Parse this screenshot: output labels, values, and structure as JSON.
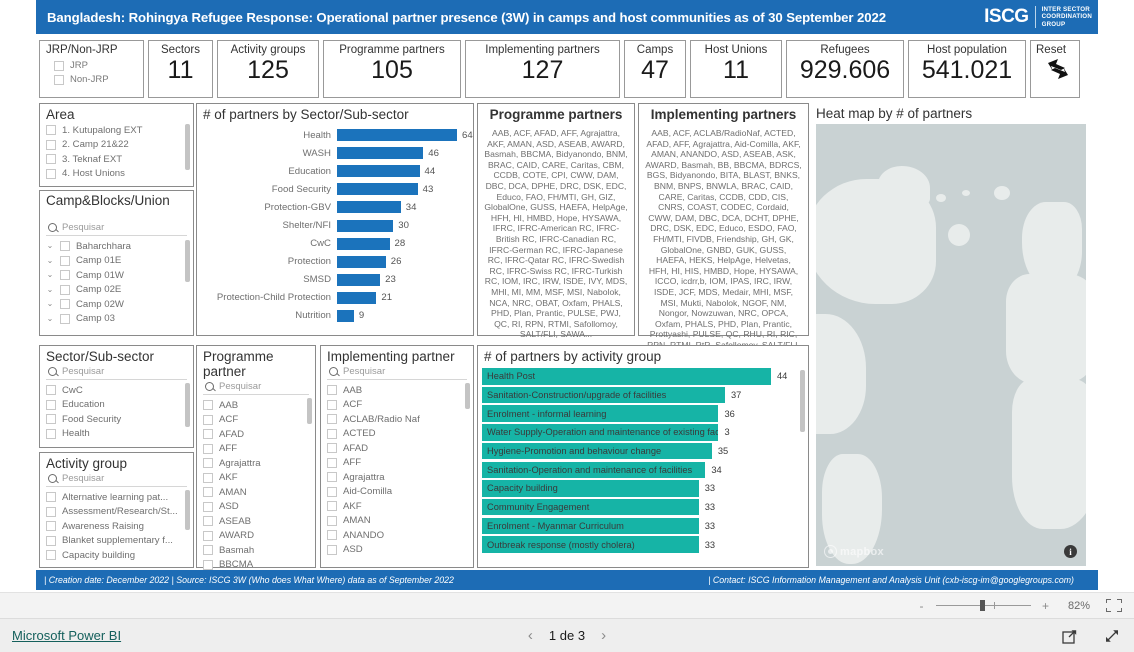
{
  "header": {
    "title": "Bangladesh: Rohingya Refugee Response: Operational partner presence (3W) in camps and host communities as of 30 September 2022",
    "logo_main": "ISCG",
    "logo_sub": "INTER SECTOR\nCOORDINATION\nGROUP",
    "bg_color": "#1d6cb5"
  },
  "kpis": {
    "jrp_slicer": {
      "label": "JRP/Non-JRP",
      "options": [
        "JRP",
        "Non-JRP"
      ]
    },
    "cards": [
      {
        "label": "Sectors",
        "value": "11"
      },
      {
        "label": "Activity groups",
        "value": "125"
      },
      {
        "label": "Programme partners",
        "value": "105"
      },
      {
        "label": "Implementing partners",
        "value": "127"
      },
      {
        "label": "Camps",
        "value": "47"
      },
      {
        "label": "Host Unions",
        "value": "11"
      },
      {
        "label": "Refugees",
        "value": "929.606"
      },
      {
        "label": "Host population",
        "value": "541.021"
      }
    ],
    "reset": {
      "label": "Reset",
      "icon": "reset-arrows-icon"
    }
  },
  "slicers": {
    "search_placeholder": "Pesquisar",
    "area": {
      "title": "Area",
      "items": [
        "1. Kutupalong EXT",
        "2. Camp 21&22",
        "3. Teknaf EXT",
        "4. Host Unions"
      ]
    },
    "camp_blocks": {
      "title": "Camp&Blocks/Union",
      "items": [
        "Baharchhara",
        "Camp 01E",
        "Camp 01W",
        "Camp 02E",
        "Camp 02W",
        "Camp 03"
      ]
    },
    "sector": {
      "title": "Sector/Sub-sector",
      "items": [
        "CwC",
        "Education",
        "Food Security",
        "Health"
      ]
    },
    "activity_group": {
      "title": "Activity group",
      "items": [
        "Alternative learning pat...",
        "Assessment/Research/St...",
        "Awareness Raising",
        "Blanket supplementary f...",
        "Capacity building"
      ]
    },
    "programme_partner": {
      "title": "Programme partner",
      "items": [
        "AAB",
        "ACF",
        "AFAD",
        "AFF",
        "Agrajattra",
        "AKF",
        "AMAN",
        "ASD",
        "ASEAB",
        "AWARD",
        "Basmah",
        "BBCMA"
      ]
    },
    "implementing_partner": {
      "title": "Implementing partner",
      "items": [
        "AAB",
        "ACF",
        "ACLAB/Radio Naf",
        "ACTED",
        "AFAD",
        "AFF",
        "Agrajattra",
        "Aid-Comilla",
        "AKF",
        "AMAN",
        "ANANDO",
        "ASD"
      ]
    }
  },
  "programme_partners_panel": {
    "title": "Programme partners",
    "text": "AAB, ACF, AFAD, AFF, Agrajattra, AKF, AMAN, ASD, ASEAB, AWARD, Basmah, BBCMA, Bidyanondo, BNM, BRAC, CAID, CARE, Caritas, CBM, CCDB, COTE, CPI, CWW, DAM, DBC, DCA, DPHE, DRC, DSK, EDC, Educo, FAO, FH/MTI, GH, GIZ, GlobalOne, GUSS, HAEFA, HelpAge, HFH, HI, HMBD, Hope, HYSAWA, IFRC, IFRC-American RC, IFRC-British RC, IFRC-Canadian RC, IFRC-German RC, IFRC-Japanese RC, IFRC-Qatar RC, IFRC-Swedish RC, IFRC-Swiss RC, IFRC-Turkish RC, IOM, IRC, IRW, ISDE, IVY, MDS, MHI, MI, MM, MSF, MSI, Nabolok, NCA, NRC, OBAT, Oxfam, PHALS, PHD, Plan, Prantic, PULSE, PWJ, QC, RI, RPN, RTMI, Safollomoy, SALT/FLI, SAWA..."
  },
  "implementing_partners_panel": {
    "title": "Implementing partners",
    "text": "AAB, ACF, ACLAB/RadioNaf, ACTED, AFAD, AFF, Agrajattra, Aid-Comilla, AKF, AMAN, ANANDO, ASD, ASEAB, ASK, AWARD, Basmah, BB, BBCMA, BDRCS, BGS, Bidyanondo, BITA, BLAST, BNKS, BNM, BNPS, BNWLA, BRAC, CAID, CARE, Caritas, CCDB, CDD, CIS, CNRS, COAST, CODEC, Cordaid, CWW, DAM, DBC, DCA, DCHT, DPHE, DRC, DSK, EDC, Educo, ESDO, FAO, FH/MTI, FIVDB, Friendship, GH, GK, GlobalOne, GNBD, GUK, GUSS, HAEFA, HEKS, HelpAge, Helvetas, HFH, HI, HIS, HMBD, Hope, HYSAWA, ICCO, icdrr,b, IOM, IPAS, IRC, IRW, ISDE, JCF, MDS, Medair, MHI, MSF, MSI, Mukti, Nabolok, NGOF, NM, Nongor, Nowzuwan, NRC, OPCA, Oxfam, PHALS, PHD, Plan, Prantic, Prottyashi, PULSE, QC, RHU, RI, RIC, RPN, RTMI, RtR, Safollomoy, SALT/FLI, SARPV, SAWAB, SBSKS, SCI, SH..."
  },
  "map_panel": {
    "title": "Heat map by # of partners",
    "attribution": "mapbox",
    "info_icon": "info-icon"
  },
  "footer": {
    "left": "| Creation date: December 2022  | Source: ISCG 3W (Who does What Where) data as of September 2022",
    "right": "| Contact: ISCG Information Management and Analysis Unit (cxb-iscg-im@googlegroups.com)"
  },
  "chrome": {
    "zoom_minus": "-",
    "zoom_plus": "+",
    "zoom_percent": "82%",
    "fit_to_page_icon": "fit-to-page-icon",
    "brand": "Microsoft Power BI",
    "page_prev_icon": "chevron-left-icon",
    "page_next_icon": "chevron-right-icon",
    "page_label": "1 de 3",
    "share_icon": "share-icon",
    "fullscreen_icon": "fullscreen-icon"
  },
  "chart_data": [
    {
      "type": "bar",
      "orientation": "horizontal",
      "title": "# of partners by Sector/Sub-sector",
      "xlabel": "",
      "ylabel": "",
      "categories": [
        "Health",
        "WASH",
        "Education",
        "Food Security",
        "Protection-GBV",
        "Shelter/NFI",
        "CwC",
        "Protection",
        "SMSD",
        "Protection-Child Protection",
        "Nutrition"
      ],
      "values": [
        64,
        46,
        44,
        43,
        34,
        30,
        28,
        26,
        23,
        21,
        9
      ],
      "xlim": [
        0,
        64
      ],
      "grid": false,
      "legend": "none",
      "bar_color": "#1b73bc",
      "data_labels": true
    },
    {
      "type": "bar",
      "orientation": "horizontal",
      "title": "# of partners by activity group",
      "xlabel": "",
      "ylabel": "",
      "categories": [
        "Health Post",
        "Sanitation-Construction/upgrade of facilities",
        "Enrolment - informal learning",
        "Water Supply-Operation and maintenance of existing facilities (incl. treatment)",
        "Hygiene-Promotion and behaviour change",
        "Sanitation-Operation and maintenance of facilities",
        "Capacity building",
        "Community Engagement",
        "Enrolment - Myanmar Curriculum",
        "Outbreak response (mostly cholera)"
      ],
      "values": [
        44,
        37,
        36,
        36,
        35,
        34,
        33,
        33,
        33,
        33
      ],
      "value_labels": [
        "44",
        "37",
        "36",
        "3",
        "35",
        "34",
        "33",
        "33",
        "33",
        "33"
      ],
      "xlim": [
        0,
        44
      ],
      "grid": false,
      "legend": "none",
      "bar_color": "#16b4a6",
      "data_labels": true
    }
  ]
}
